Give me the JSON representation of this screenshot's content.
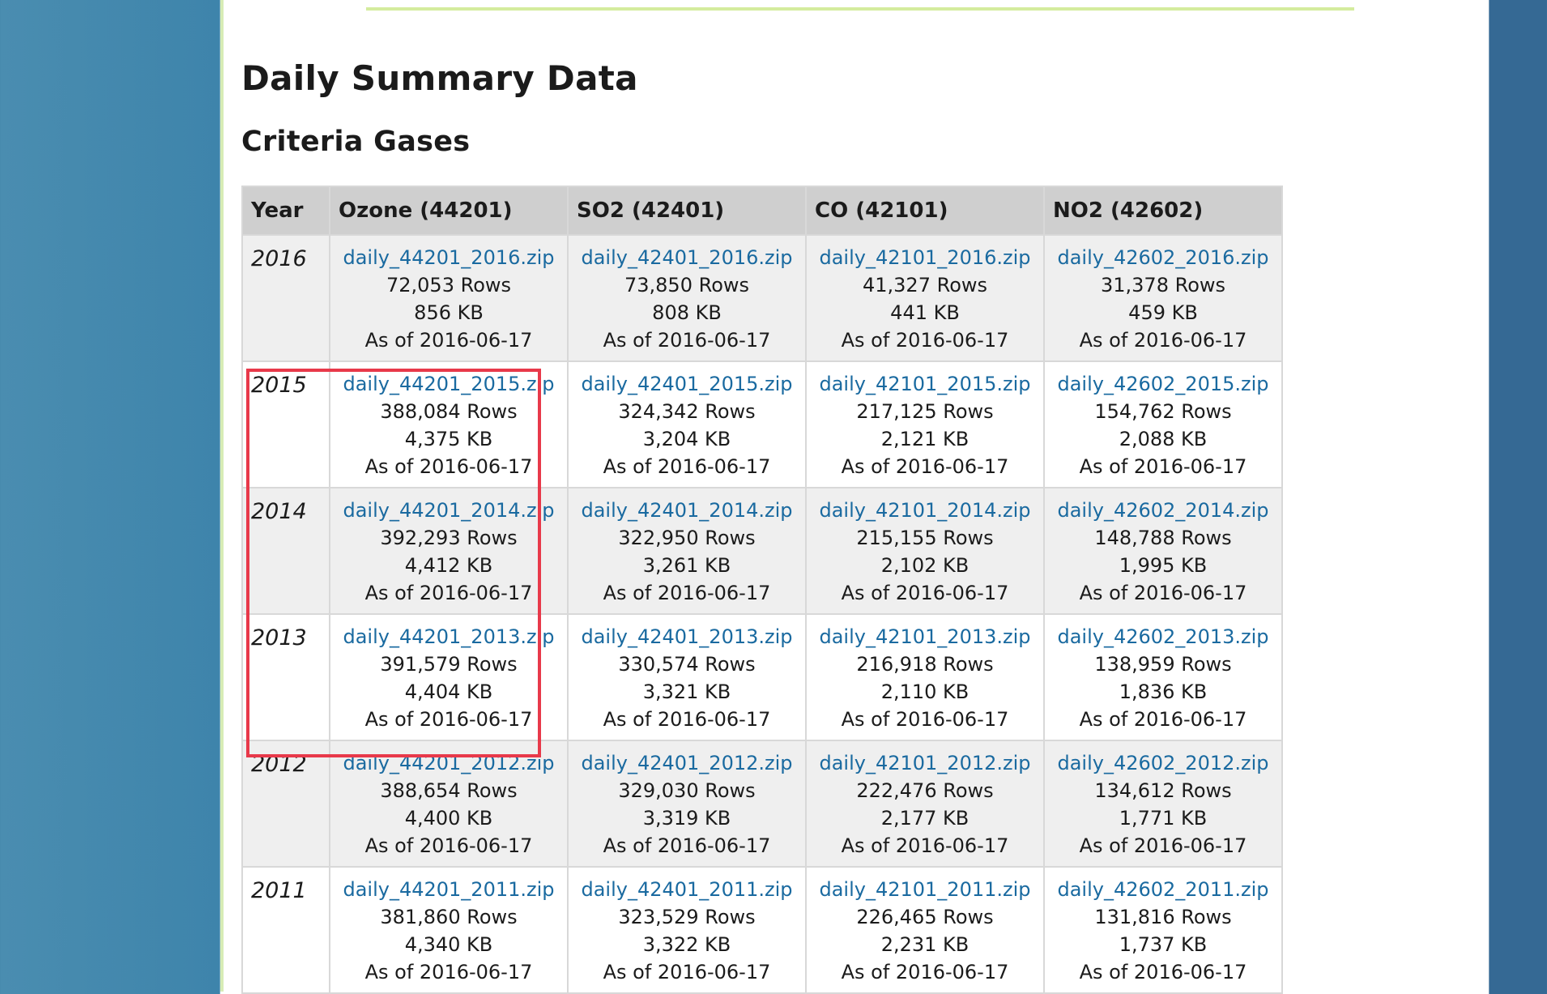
{
  "page": {
    "title": "Daily Summary Data",
    "section": "Criteria Gases"
  },
  "table": {
    "headers": [
      "Year",
      "Ozone (44201)",
      "SO2 (42401)",
      "CO (42101)",
      "NO2 (42602)"
    ],
    "rows": [
      {
        "year": "2016",
        "cells": [
          {
            "file": "daily_44201_2016.zip",
            "rows": "72,053 Rows",
            "size": "856 KB",
            "asof": "As of 2016-06-17"
          },
          {
            "file": "daily_42401_2016.zip",
            "rows": "73,850 Rows",
            "size": "808 KB",
            "asof": "As of 2016-06-17"
          },
          {
            "file": "daily_42101_2016.zip",
            "rows": "41,327 Rows",
            "size": "441 KB",
            "asof": "As of 2016-06-17"
          },
          {
            "file": "daily_42602_2016.zip",
            "rows": "31,378 Rows",
            "size": "459 KB",
            "asof": "As of 2016-06-17"
          }
        ]
      },
      {
        "year": "2015",
        "cells": [
          {
            "file": "daily_44201_2015.zip",
            "rows": "388,084 Rows",
            "size": "4,375 KB",
            "asof": "As of 2016-06-17"
          },
          {
            "file": "daily_42401_2015.zip",
            "rows": "324,342 Rows",
            "size": "3,204 KB",
            "asof": "As of 2016-06-17"
          },
          {
            "file": "daily_42101_2015.zip",
            "rows": "217,125 Rows",
            "size": "2,121 KB",
            "asof": "As of 2016-06-17"
          },
          {
            "file": "daily_42602_2015.zip",
            "rows": "154,762 Rows",
            "size": "2,088 KB",
            "asof": "As of 2016-06-17"
          }
        ]
      },
      {
        "year": "2014",
        "cells": [
          {
            "file": "daily_44201_2014.zip",
            "rows": "392,293 Rows",
            "size": "4,412 KB",
            "asof": "As of 2016-06-17"
          },
          {
            "file": "daily_42401_2014.zip",
            "rows": "322,950 Rows",
            "size": "3,261 KB",
            "asof": "As of 2016-06-17"
          },
          {
            "file": "daily_42101_2014.zip",
            "rows": "215,155 Rows",
            "size": "2,102 KB",
            "asof": "As of 2016-06-17"
          },
          {
            "file": "daily_42602_2014.zip",
            "rows": "148,788 Rows",
            "size": "1,995 KB",
            "asof": "As of 2016-06-17"
          }
        ]
      },
      {
        "year": "2013",
        "cells": [
          {
            "file": "daily_44201_2013.zip",
            "rows": "391,579 Rows",
            "size": "4,404 KB",
            "asof": "As of 2016-06-17"
          },
          {
            "file": "daily_42401_2013.zip",
            "rows": "330,574 Rows",
            "size": "3,321 KB",
            "asof": "As of 2016-06-17"
          },
          {
            "file": "daily_42101_2013.zip",
            "rows": "216,918 Rows",
            "size": "2,110 KB",
            "asof": "As of 2016-06-17"
          },
          {
            "file": "daily_42602_2013.zip",
            "rows": "138,959 Rows",
            "size": "1,836 KB",
            "asof": "As of 2016-06-17"
          }
        ]
      },
      {
        "year": "2012",
        "cells": [
          {
            "file": "daily_44201_2012.zip",
            "rows": "388,654 Rows",
            "size": "4,400 KB",
            "asof": "As of 2016-06-17"
          },
          {
            "file": "daily_42401_2012.zip",
            "rows": "329,030 Rows",
            "size": "3,319 KB",
            "asof": "As of 2016-06-17"
          },
          {
            "file": "daily_42101_2012.zip",
            "rows": "222,476 Rows",
            "size": "2,177 KB",
            "asof": "As of 2016-06-17"
          },
          {
            "file": "daily_42602_2012.zip",
            "rows": "134,612 Rows",
            "size": "1,771 KB",
            "asof": "As of 2016-06-17"
          }
        ]
      },
      {
        "year": "2011",
        "cells": [
          {
            "file": "daily_44201_2011.zip",
            "rows": "381,860 Rows",
            "size": "4,340 KB",
            "asof": "As of 2016-06-17"
          },
          {
            "file": "daily_42401_2011.zip",
            "rows": "323,529 Rows",
            "size": "3,322 KB",
            "asof": "As of 2016-06-17"
          },
          {
            "file": "daily_42101_2011.zip",
            "rows": "226,465 Rows",
            "size": "2,231 KB",
            "asof": "As of 2016-06-17"
          },
          {
            "file": "daily_42602_2011.zip",
            "rows": "131,816 Rows",
            "size": "1,737 KB",
            "asof": "As of 2016-06-17"
          }
        ]
      }
    ]
  },
  "colors": {
    "link": "#1a6aa0",
    "header_bg": "#cfcfcf",
    "shaded_row": "#efefef",
    "highlight_border": "#e8394a",
    "left_sidebar": "#3e84ab",
    "right_sidebar": "#356994",
    "accent_rule": "#d4ec9e"
  }
}
